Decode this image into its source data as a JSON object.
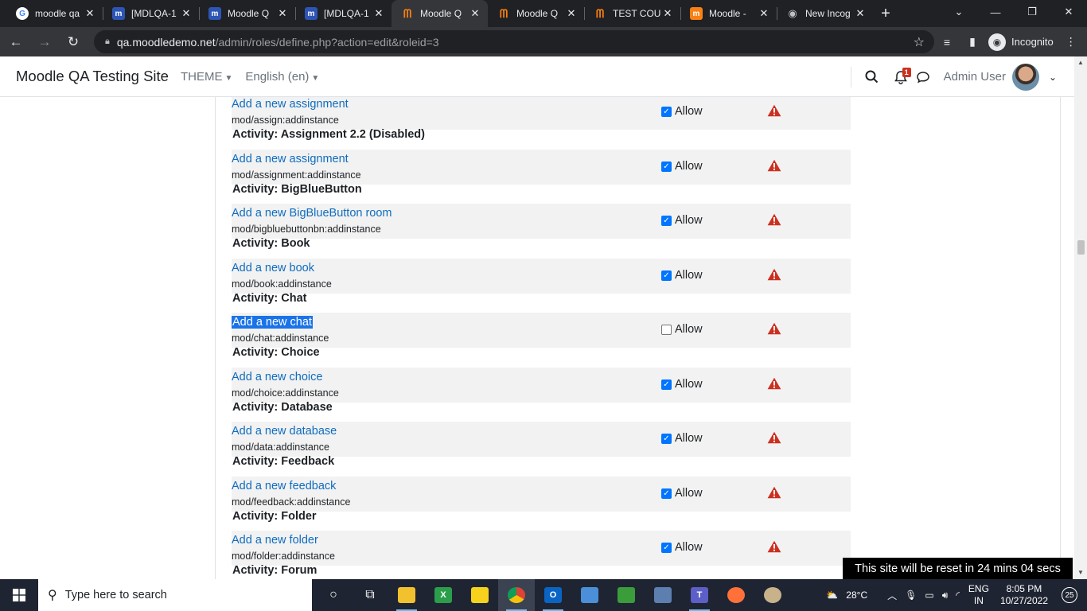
{
  "browser": {
    "tabs": [
      {
        "title": "moodle qa",
        "favicon": "google-icon",
        "active": false
      },
      {
        "title": "[MDLQA-1",
        "favicon": "jira-icon",
        "active": false
      },
      {
        "title": "Moodle Q",
        "favicon": "jira-icon",
        "active": false
      },
      {
        "title": "[MDLQA-1",
        "favicon": "jira-icon",
        "active": false
      },
      {
        "title": "Moodle Q",
        "favicon": "moodle-icon",
        "active": true
      },
      {
        "title": "Moodle Q",
        "favicon": "moodle-icon",
        "active": false
      },
      {
        "title": "TEST COU",
        "favicon": "moodle-icon",
        "active": false
      },
      {
        "title": "Moodle - ",
        "favicon": "moodle-orange-icon",
        "active": false
      },
      {
        "title": "New Incog",
        "favicon": "incognito-icon",
        "active": false
      }
    ],
    "url_host": "qa.moodledemo.net",
    "url_path": "/admin/roles/define.php?action=edit&roleid=3",
    "profile_label": "Incognito"
  },
  "navbar": {
    "site_name": "Moodle QA Testing Site",
    "theme_label": "THEME",
    "language_label": "English (en)",
    "notification_count": "1",
    "user_name": "Admin User"
  },
  "permissions": {
    "items": [
      {
        "kind": "cap",
        "name": "Add a new assignment",
        "id": "mod/assign:addinstance",
        "allow_label": "Allow",
        "checked": true,
        "shade": true
      },
      {
        "kind": "heading",
        "text": "Activity: Assignment 2.2 (Disabled)"
      },
      {
        "kind": "cap",
        "name": "Add a new assignment",
        "id": "mod/assignment:addinstance",
        "allow_label": "Allow",
        "checked": true,
        "shade": true
      },
      {
        "kind": "heading",
        "text": "Activity: BigBlueButton"
      },
      {
        "kind": "cap",
        "name": "Add a new BigBlueButton room",
        "id": "mod/bigbluebuttonbn:addinstance",
        "allow_label": "Allow",
        "checked": true,
        "shade": true
      },
      {
        "kind": "heading",
        "text": "Activity: Book"
      },
      {
        "kind": "cap",
        "name": "Add a new book",
        "id": "mod/book:addinstance",
        "allow_label": "Allow",
        "checked": true,
        "shade": true
      },
      {
        "kind": "heading",
        "text": "Activity: Chat"
      },
      {
        "kind": "cap",
        "name": "Add a new chat",
        "id": "mod/chat:addinstance",
        "allow_label": "Allow",
        "checked": false,
        "shade": true,
        "selected": true
      },
      {
        "kind": "heading",
        "text": "Activity: Choice"
      },
      {
        "kind": "cap",
        "name": "Add a new choice",
        "id": "mod/choice:addinstance",
        "allow_label": "Allow",
        "checked": true,
        "shade": true
      },
      {
        "kind": "heading",
        "text": "Activity: Database"
      },
      {
        "kind": "cap",
        "name": "Add a new database",
        "id": "mod/data:addinstance",
        "allow_label": "Allow",
        "checked": true,
        "shade": true
      },
      {
        "kind": "heading",
        "text": "Activity: Feedback"
      },
      {
        "kind": "cap",
        "name": "Add a new feedback",
        "id": "mod/feedback:addinstance",
        "allow_label": "Allow",
        "checked": true,
        "shade": true
      },
      {
        "kind": "heading",
        "text": "Activity: Folder"
      },
      {
        "kind": "cap",
        "name": "Add a new folder",
        "id": "mod/folder:addinstance",
        "allow_label": "Allow",
        "checked": true,
        "shade": true
      },
      {
        "kind": "heading",
        "text": "Activity: Forum"
      }
    ]
  },
  "reset_notice": "This site will be reset in 24 mins 04 secs",
  "taskbar": {
    "search_placeholder": "Type here to search",
    "weather": "28°C",
    "lang_line1": "ENG",
    "lang_line2": "IN",
    "time": "8:05 PM",
    "date": "10/27/2022",
    "notifications": "25"
  },
  "colors": {
    "link": "#0f6cbf",
    "risk": "#ca3120",
    "checkbox": "#0075ff",
    "selection": "#1a73e8"
  }
}
